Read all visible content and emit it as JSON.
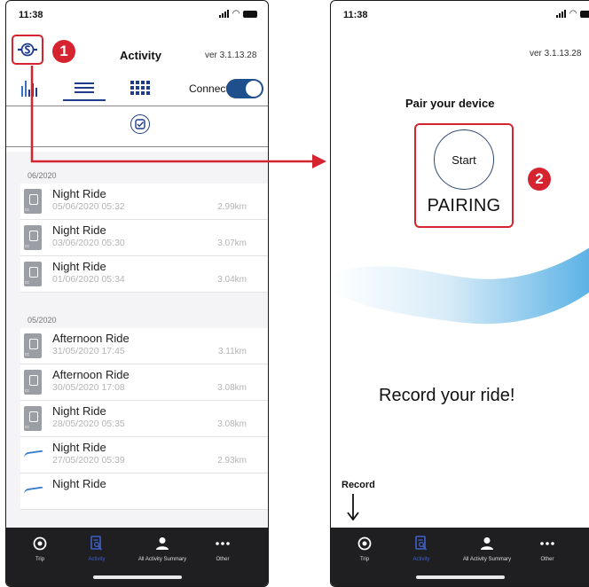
{
  "left": {
    "status": {
      "time": "11:38"
    },
    "marker": "1",
    "header": {
      "title": "Activity",
      "version": "ver 3.1.13.28"
    },
    "connect_label": "Connect",
    "groups": [
      {
        "month": "06/2020",
        "rides": [
          {
            "name": "Night Ride",
            "date": "05/06/2020 05:32",
            "distance": "2.99km",
            "thumb": "device"
          },
          {
            "name": "Night Ride",
            "date": "03/06/2020 05:30",
            "distance": "3.07km",
            "thumb": "device"
          },
          {
            "name": "Night Ride",
            "date": "01/06/2020 05:34",
            "distance": "3.04km",
            "thumb": "device"
          }
        ]
      },
      {
        "month": "05/2020",
        "rides": [
          {
            "name": "Afternoon Ride",
            "date": "31/05/2020 17:45",
            "distance": "3.11km",
            "thumb": "device"
          },
          {
            "name": "Afternoon Ride",
            "date": "30/05/2020 17:08",
            "distance": "3.08km",
            "thumb": "device"
          },
          {
            "name": "Night Ride",
            "date": "28/05/2020 05:35",
            "distance": "3.08km",
            "thumb": "device"
          },
          {
            "name": "Night Ride",
            "date": "27/05/2020 05:39",
            "distance": "2.93km",
            "thumb": "map"
          },
          {
            "name": "Night Ride",
            "date": "",
            "distance": "",
            "thumb": "map"
          }
        ]
      }
    ],
    "tabs": [
      {
        "label": "Trip",
        "icon": "record-icon",
        "active": false
      },
      {
        "label": "Activity",
        "icon": "activity-icon",
        "active": true
      },
      {
        "label": "All Activity Summary",
        "icon": "person-icon",
        "active": false
      },
      {
        "label": "Other",
        "icon": "more-icon",
        "active": false
      }
    ]
  },
  "right": {
    "status": {
      "time": "11:38"
    },
    "version": "ver 3.1.13.28",
    "pair_title": "Pair your device",
    "start_label": "Start",
    "pairing_label": "PAIRING",
    "marker": "2",
    "record_ride": "Record your ride!",
    "record_label": "Record",
    "tabs": [
      {
        "label": "Trip",
        "icon": "record-icon",
        "active": false
      },
      {
        "label": "Activity",
        "icon": "activity-icon",
        "active": true
      },
      {
        "label": "All Activity Summary",
        "icon": "person-icon",
        "active": false
      },
      {
        "label": "Other",
        "icon": "more-icon",
        "active": false
      }
    ]
  },
  "colors": {
    "highlight": "#d5232f",
    "accent": "#1f4f8c",
    "tab_active": "#3e60c9",
    "tabbar": "#1f1f22"
  }
}
